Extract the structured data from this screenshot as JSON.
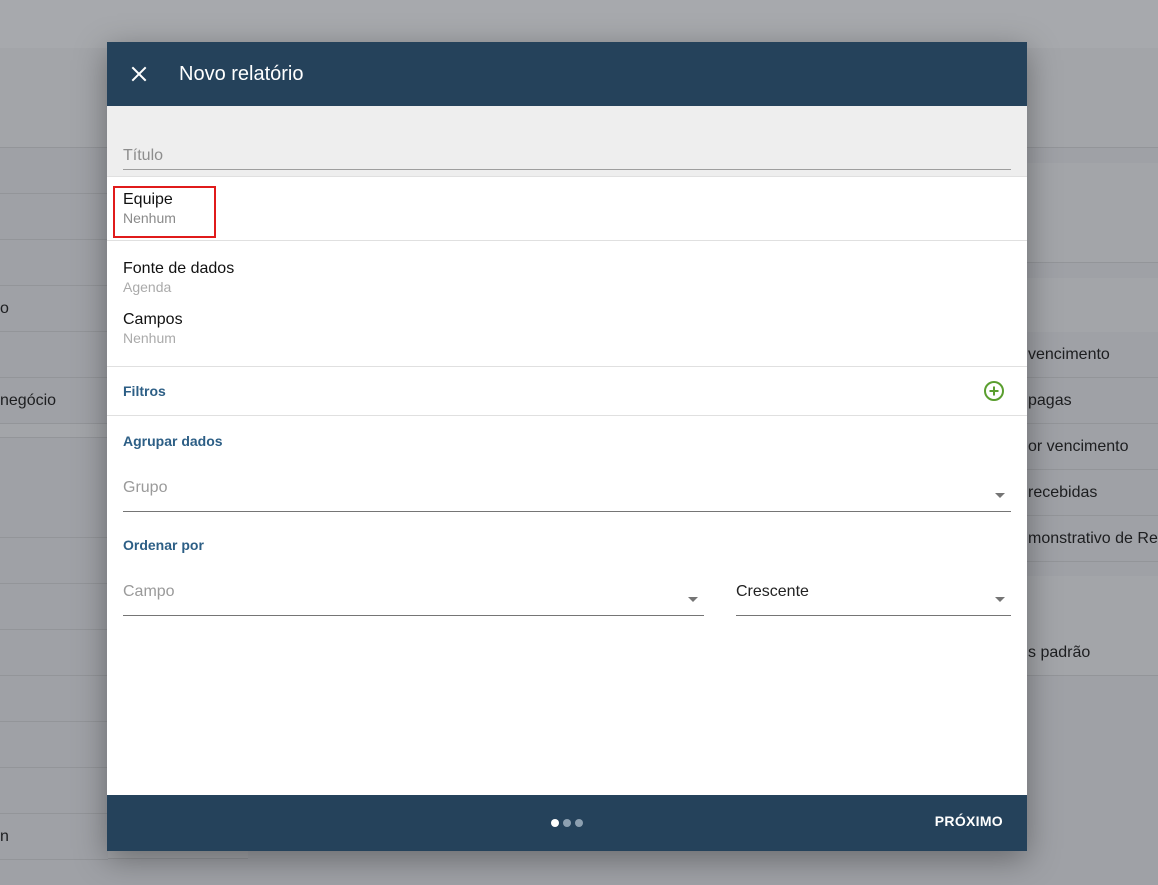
{
  "background": {
    "left_rows": [
      "",
      "",
      "",
      "o",
      "",
      "negócio",
      "",
      "",
      "",
      "",
      "",
      "",
      "",
      "n"
    ],
    "right_rows": [
      "vencimento",
      "pagas",
      "or vencimento",
      "recebidas",
      "monstrativo de Res",
      "s padrão"
    ]
  },
  "modal": {
    "title": "Novo relatório",
    "title_field": {
      "placeholder": "Título",
      "value": ""
    },
    "equipe": {
      "label": "Equipe",
      "value": "Nenhum"
    },
    "fonte": {
      "label": "Fonte de dados",
      "value": "Agenda"
    },
    "campos": {
      "label": "Campos",
      "value": "Nenhum"
    },
    "filtros": {
      "label": "Filtros"
    },
    "agrupar": {
      "label": "Agrupar dados",
      "placeholder": "Grupo"
    },
    "ordenar": {
      "label": "Ordenar por",
      "field_placeholder": "Campo",
      "direction": "Crescente"
    },
    "footer": {
      "next_label": "PRÓXIMO",
      "steps_total": 3,
      "current_step": 1
    }
  },
  "colors": {
    "header": "#25425b",
    "accent_text": "#2c5e85",
    "add_icon": "#5a9e2f",
    "highlight": "#e01b1b"
  }
}
